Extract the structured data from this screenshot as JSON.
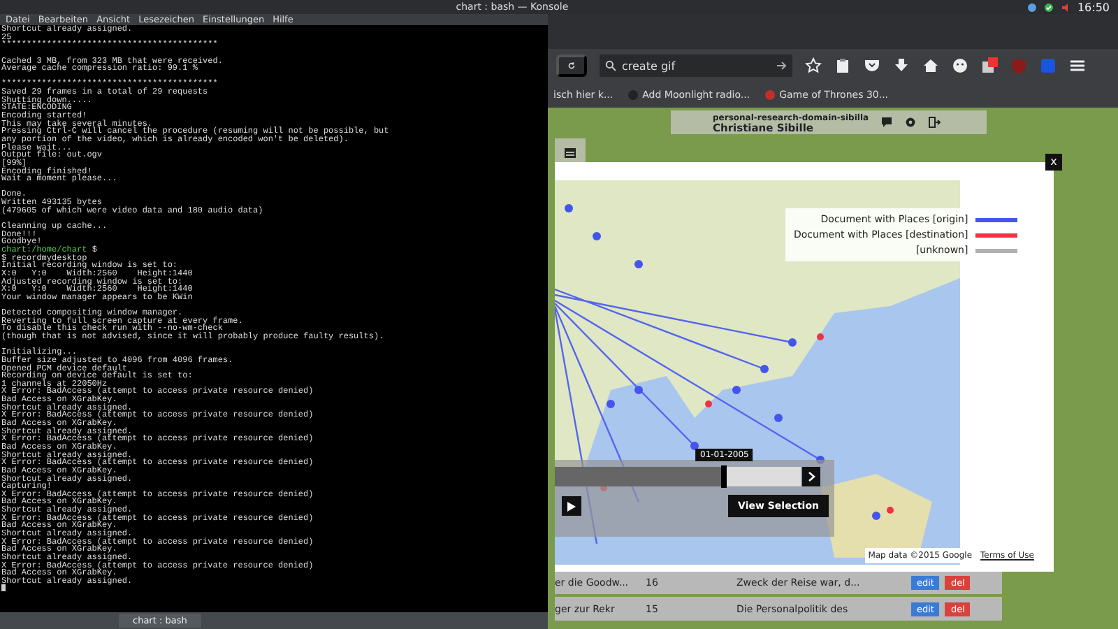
{
  "top_panel": {
    "window_title": "chart : bash — Konsole",
    "clock": "16:50"
  },
  "terminal": {
    "menu": [
      "Datei",
      "Bearbeiten",
      "Ansicht",
      "Lesezeichen",
      "Einstellungen",
      "Hilfe"
    ],
    "lines": [
      {
        "kind": "text",
        "text": "Shortcut already assigned."
      },
      {
        "kind": "text",
        "text": "25"
      },
      {
        "kind": "text",
        "text": "*******************************************"
      },
      {
        "kind": "blank"
      },
      {
        "kind": "text",
        "text": "Cached 3 MB, from 323 MB that were received."
      },
      {
        "kind": "text",
        "text": "Average cache compression ratio: 99.1 %"
      },
      {
        "kind": "blank"
      },
      {
        "kind": "text",
        "text": "*******************************************"
      },
      {
        "kind": "text",
        "text": "Saved 29 frames in a total of 29 requests"
      },
      {
        "kind": "text",
        "text": "Shutting down....."
      },
      {
        "kind": "text",
        "text": "STATE:ENCODING"
      },
      {
        "kind": "text",
        "text": "Encoding started!"
      },
      {
        "kind": "text",
        "text": "This may take several minutes."
      },
      {
        "kind": "text",
        "text": "Pressing Ctrl-C will cancel the procedure (resuming will not be possible, but"
      },
      {
        "kind": "text",
        "text": "any portion of the video, which is already encoded won't be deleted)."
      },
      {
        "kind": "text",
        "text": "Please wait..."
      },
      {
        "kind": "text",
        "text": "Output file: out.ogv"
      },
      {
        "kind": "text",
        "text": "[99%]"
      },
      {
        "kind": "text",
        "text": "Encoding finished!"
      },
      {
        "kind": "text",
        "text": "Wait a moment please..."
      },
      {
        "kind": "blank"
      },
      {
        "kind": "text",
        "text": "Done."
      },
      {
        "kind": "text",
        "text": "Written 493135 bytes"
      },
      {
        "kind": "text",
        "text": "(479605 of which were video data and 180 audio data)"
      },
      {
        "kind": "blank"
      },
      {
        "kind": "text",
        "text": "Cleanning up cache..."
      },
      {
        "kind": "text",
        "text": "Done!!!"
      },
      {
        "kind": "text",
        "text": "Goodbye!"
      },
      {
        "kind": "prompt",
        "prompt": "chart:/home/chart",
        "command": " $"
      },
      {
        "kind": "text",
        "text": "$ recordmydesktop"
      },
      {
        "kind": "text",
        "text": "Initial recording window is set to:"
      },
      {
        "kind": "text",
        "text": "X:0   Y:0    Width:2560    Height:1440"
      },
      {
        "kind": "text",
        "text": "Adjusted recording window is set to:"
      },
      {
        "kind": "text",
        "text": "X:0   Y:0    Width:2560    Height:1440"
      },
      {
        "kind": "text",
        "text": "Your window manager appears to be KWin"
      },
      {
        "kind": "blank"
      },
      {
        "kind": "text",
        "text": "Detected compositing window manager."
      },
      {
        "kind": "text",
        "text": "Reverting to full screen capture at every frame."
      },
      {
        "kind": "text",
        "text": "To disable this check run with --no-wm-check"
      },
      {
        "kind": "text",
        "text": "(though that is not advised, since it will probably produce faulty results)."
      },
      {
        "kind": "blank"
      },
      {
        "kind": "text",
        "text": "Initializing..."
      },
      {
        "kind": "text",
        "text": "Buffer size adjusted to 4096 from 4096 frames."
      },
      {
        "kind": "text",
        "text": "Opened PCM device default"
      },
      {
        "kind": "text",
        "text": "Recording on device default is set to:"
      },
      {
        "kind": "text",
        "text": "1 channels at 22050Hz"
      },
      {
        "kind": "text",
        "text": "X Error: BadAccess (attempt to access private resource denied)"
      },
      {
        "kind": "text",
        "text": "Bad Access on XGrabKey."
      },
      {
        "kind": "text",
        "text": "Shortcut already assigned."
      },
      {
        "kind": "text",
        "text": "X Error: BadAccess (attempt to access private resource denied)"
      },
      {
        "kind": "text",
        "text": "Bad Access on XGrabKey."
      },
      {
        "kind": "text",
        "text": "Shortcut already assigned."
      },
      {
        "kind": "text",
        "text": "X Error: BadAccess (attempt to access private resource denied)"
      },
      {
        "kind": "text",
        "text": "Bad Access on XGrabKey."
      },
      {
        "kind": "text",
        "text": "Shortcut already assigned."
      },
      {
        "kind": "text",
        "text": "X Error: BadAccess (attempt to access private resource denied)"
      },
      {
        "kind": "text",
        "text": "Bad Access on XGrabKey."
      },
      {
        "kind": "text",
        "text": "Shortcut already assigned."
      },
      {
        "kind": "text",
        "text": "Capturing!"
      },
      {
        "kind": "text",
        "text": "X Error: BadAccess (attempt to access private resource denied)"
      },
      {
        "kind": "text",
        "text": "Bad Access on XGrabKey."
      },
      {
        "kind": "text",
        "text": "Shortcut already assigned."
      },
      {
        "kind": "text",
        "text": "X Error: BadAccess (attempt to access private resource denied)"
      },
      {
        "kind": "text",
        "text": "Bad Access on XGrabKey."
      },
      {
        "kind": "text",
        "text": "Shortcut already assigned."
      },
      {
        "kind": "text",
        "text": "X Error: BadAccess (attempt to access private resource denied)"
      },
      {
        "kind": "text",
        "text": "Bad Access on XGrabKey."
      },
      {
        "kind": "text",
        "text": "Shortcut already assigned."
      },
      {
        "kind": "text",
        "text": "X Error: BadAccess (attempt to access private resource denied)"
      },
      {
        "kind": "text",
        "text": "Bad Access on XGrabKey."
      },
      {
        "kind": "text",
        "text": "Shortcut already assigned."
      },
      {
        "kind": "cursor"
      }
    ],
    "tab": "chart : bash"
  },
  "browser": {
    "address": "create gif",
    "bookmarks": [
      "isch hier k...",
      "Add Moonlight radio...",
      "Game of Thrones 30..."
    ],
    "header": {
      "domain": "personal-research-domain-sibilla",
      "user": "Christiane Sibille"
    },
    "modal": {
      "close": "x",
      "legend": [
        {
          "label": "Document with Places [origin]",
          "color": "#4455ee"
        },
        {
          "label": "Document with Places [destination]",
          "color": "#ee3344"
        },
        {
          "label": "[unknown]",
          "color": "#b0b0b0"
        }
      ],
      "timeline": {
        "date": "01-01-2005",
        "level": 0.69
      },
      "view_button": "View Selection",
      "attribution": "Map data ©2015 Google",
      "terms_link": "Terms of Use"
    },
    "table_rows": [
      {
        "title": "er die Goodw...",
        "count": "16",
        "excerpt": "Zweck der Reise war, d...",
        "edit": "edit",
        "del": "del"
      },
      {
        "title": "ger zur Rekr",
        "count": "15",
        "excerpt": "Die Personalpolitik des",
        "edit": "edit",
        "del": "del"
      }
    ]
  }
}
